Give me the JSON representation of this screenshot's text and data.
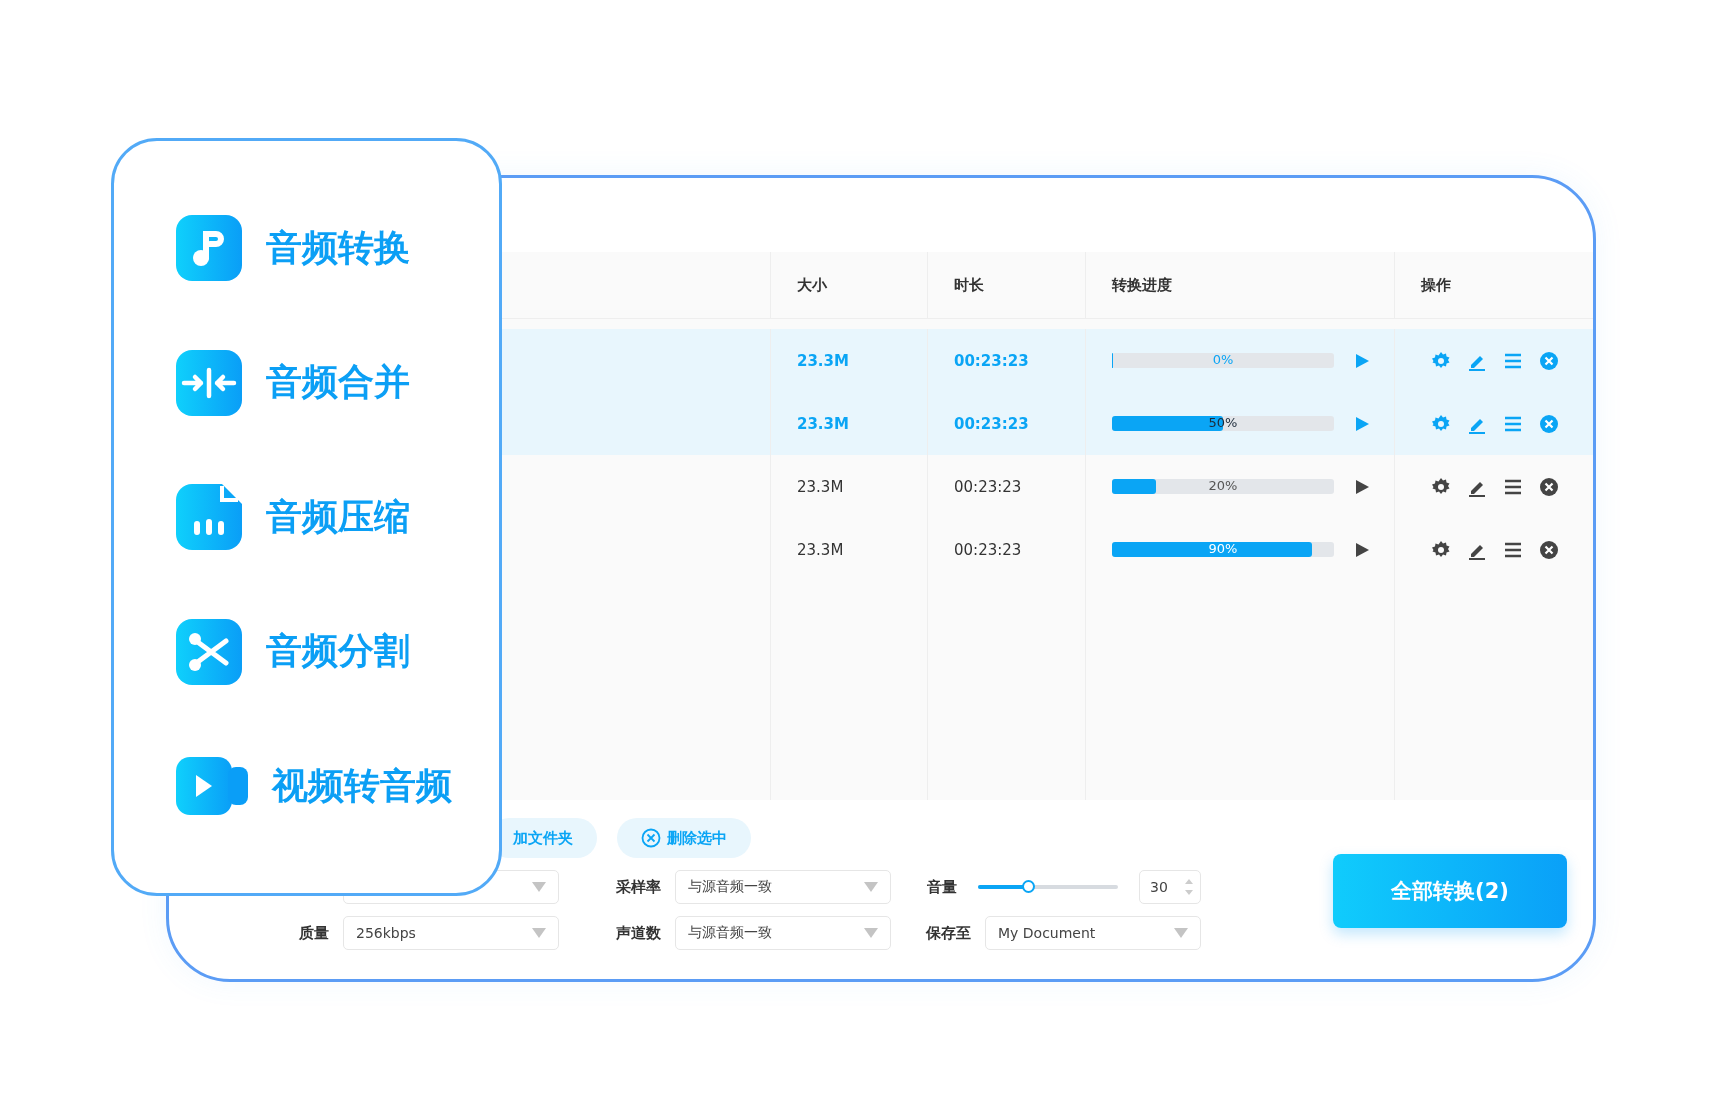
{
  "sidebar": {
    "items": [
      {
        "label": "音频转换"
      },
      {
        "label": "音频合并"
      },
      {
        "label": "音频压缩"
      },
      {
        "label": "音频分割"
      },
      {
        "label": "视频转音频"
      }
    ]
  },
  "table": {
    "columns": [
      "大小",
      "时长",
      "转换进度",
      "操作"
    ],
    "rows": [
      {
        "size": "23.3M",
        "duration": "00:23:23",
        "progress": "0%",
        "level": 0,
        "selected": true
      },
      {
        "size": "23.3M",
        "duration": "00:23:23",
        "progress": "50%",
        "level": 0.5,
        "selected": true
      },
      {
        "size": "23.3M",
        "duration": "00:23:23",
        "progress": "20%",
        "level": 0.2,
        "selected": false
      },
      {
        "size": "23.3M",
        "duration": "00:23:23",
        "progress": "90%",
        "level": 0.9,
        "selected": false
      }
    ]
  },
  "actions": [
    {
      "label": "加文件夹"
    },
    {
      "label": "删除选中"
    }
  ],
  "settings": [
    [
      {
        "kind": "select"
      },
      {
        "kind": "select",
        "label": "采样率",
        "value": "与源音频一致"
      },
      {
        "kind": "slider",
        "label": "音量",
        "level": 0.36,
        "value": "30"
      }
    ],
    [
      {
        "kind": "select",
        "label": "质量",
        "value": "256kbps"
      },
      {
        "kind": "select",
        "label": "声道数",
        "value": "与源音频一致"
      },
      {
        "kind": "select",
        "label": "保存至",
        "value": "My Document"
      }
    ]
  ],
  "convert_button": "全部转换(2)"
}
